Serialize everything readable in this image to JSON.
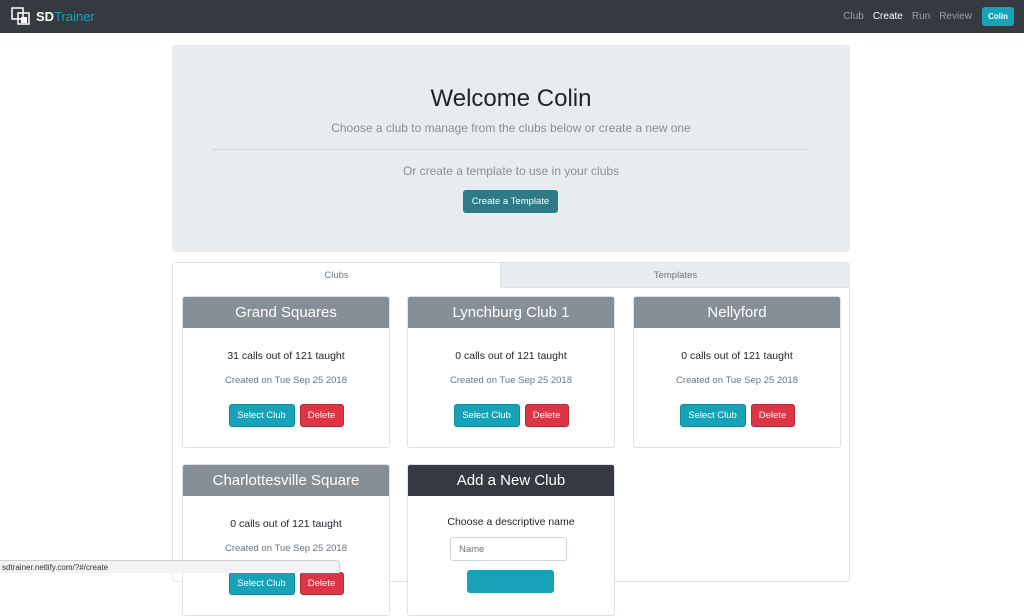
{
  "nav": {
    "brand_sd": "SD",
    "brand_trainer": "Trainer",
    "links": [
      "Club",
      "Create",
      "Run",
      "Review"
    ],
    "active_link": "Create",
    "user": "Colin",
    "colors": {
      "navbar": "#343a40",
      "accent": "#17a2b8"
    }
  },
  "hero": {
    "title": "Welcome Colin",
    "subtitle": "Choose a club to manage from the clubs below or create a new one",
    "template_prompt": "Or create a template to use in your clubs",
    "template_button": "Create a Template"
  },
  "tabs": [
    "Clubs",
    "Templates"
  ],
  "clubs": [
    {
      "name": "Grand Squares",
      "count": "31 calls out of 121 taught",
      "created": "Created on Tue Sep 25 2018",
      "select_label": "Select Club",
      "delete_label": "Delete"
    },
    {
      "name": "Lynchburg Club 1",
      "count": "0 calls out of 121 taught",
      "created": "Created on Tue Sep 25 2018",
      "select_label": "Select Club",
      "delete_label": "Delete"
    },
    {
      "name": "Nellyford",
      "count": "0 calls out of 121 taught",
      "created": "Created on Tue Sep 25 2018",
      "select_label": "Select Club",
      "delete_label": "Delete"
    },
    {
      "name": "Charlottesville Square",
      "count": "0 calls out of 121 taught",
      "created": "Created on Tue Sep 25 2018",
      "select_label": "Select Club",
      "delete_label": "Delete"
    }
  ],
  "add_club": {
    "title": "Add a New Club",
    "label": "Choose a descriptive name",
    "placeholder": "Name"
  },
  "status_url": "sdtrainer.netlify.com/?#/create"
}
